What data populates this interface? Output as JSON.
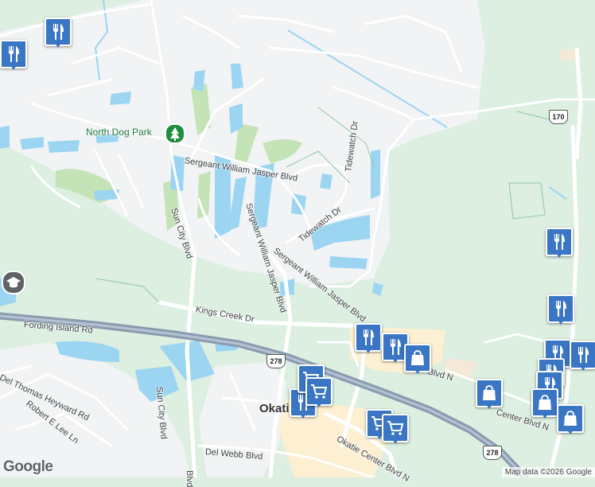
{
  "map": {
    "colors": {
      "land": "#dcefe0",
      "residential": "#f1f3f4",
      "water": "#9bd5f2",
      "highway": "#8a9bb1",
      "road": "#ffffff",
      "golf": "#c4e3b7",
      "commercial": "#fdf0d2"
    },
    "labels": {
      "north_dog_park": "North Dog Park",
      "sergeant_jasper_upper": "Sergeant William Jasper Blvd",
      "sergeant_jasper_lower": "Sergeant William Jasper Blvd",
      "sun_city_upper": "Sun City Blvd",
      "sun_city_lower": "Sun City Blvd",
      "tidewatch_upper": "Tidewatch Dr",
      "tidewatch_lower": "Tidewatch Dr",
      "kings_creek": "Kings Creek Dr",
      "fording_island": "Fording Island Rd",
      "okatie": "Okatie",
      "del_thomas": "Del Thomas Heyward Rd",
      "robert_lee": "Robert E Lee Ln",
      "del_webb": "Del Webb Blvd",
      "okatie_center": "Okatie Center Blvd N",
      "center_blvd_n": "Center Blvd N",
      "blvd_n": "Blvd N",
      "blvd_bottom": "Blvd"
    },
    "shields": [
      "278",
      "170",
      "278"
    ],
    "pins": [
      {
        "name": "restaurant-pin-1",
        "icon": "restaurant-icon"
      },
      {
        "name": "restaurant-pin-2",
        "icon": "restaurant-icon"
      },
      {
        "name": "restaurant-pin-3",
        "icon": "restaurant-icon"
      },
      {
        "name": "restaurant-pin-4",
        "icon": "restaurant-icon"
      },
      {
        "name": "restaurant-pin-5",
        "icon": "restaurant-icon"
      },
      {
        "name": "restaurant-pin-6",
        "icon": "restaurant-icon"
      },
      {
        "name": "restaurant-pin-7",
        "icon": "restaurant-icon"
      },
      {
        "name": "restaurant-pin-8",
        "icon": "restaurant-icon"
      },
      {
        "name": "restaurant-pin-9",
        "icon": "restaurant-icon"
      },
      {
        "name": "restaurant-pin-10",
        "icon": "restaurant-icon"
      },
      {
        "name": "restaurant-pin-11",
        "icon": "restaurant-icon"
      },
      {
        "name": "shopping-pin-1",
        "icon": "shopping-bag-icon"
      },
      {
        "name": "shopping-pin-2",
        "icon": "shopping-bag-icon"
      },
      {
        "name": "shopping-pin-3",
        "icon": "shopping-bag-icon"
      },
      {
        "name": "shopping-pin-4",
        "icon": "shopping-bag-icon"
      },
      {
        "name": "grocery-pin-1",
        "icon": "shopping-cart-icon"
      },
      {
        "name": "grocery-pin-2",
        "icon": "shopping-cart-icon"
      },
      {
        "name": "grocery-pin-3",
        "icon": "shopping-cart-icon"
      },
      {
        "name": "grocery-pin-4",
        "icon": "shopping-cart-icon"
      }
    ],
    "logo": "Google",
    "attribution": "Map data ©2026 Google"
  }
}
